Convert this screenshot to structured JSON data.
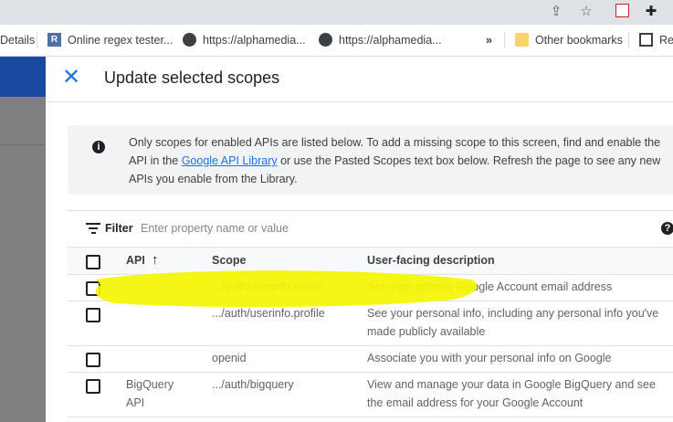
{
  "browser": {
    "bookmarks": [
      {
        "label": "Details",
        "icon": "page-icon"
      },
      {
        "label": "Online regex tester...",
        "icon": "regex-icon"
      },
      {
        "label": "https://alphamedia...",
        "icon": "globe-icon"
      },
      {
        "label": "https://alphamedia...",
        "icon": "globe-icon"
      },
      {
        "label": "»",
        "icon": "chevron-icon"
      },
      {
        "label": "Other bookmarks",
        "icon": "folder-icon"
      },
      {
        "label": "Re",
        "icon": "reading-list-icon"
      }
    ]
  },
  "dialog": {
    "title": "Update selected scopes",
    "info": {
      "before_link": "Only scopes for enabled APIs are listed below. To add a missing scope to this screen, find and enable the API in the ",
      "link": "Google API Library",
      "after_link": " or use the Pasted Scopes text box below. Refresh the page to see any new APIs you enable from the Library."
    },
    "filter": {
      "label": "Filter",
      "placeholder": "Enter property name or value"
    },
    "table": {
      "columns": [
        "API",
        "Scope",
        "User-facing description"
      ],
      "sort_column": "API",
      "rows": [
        {
          "api": "",
          "scope": ".../auth/userinfo.email",
          "description": "See your primary Google Account email address"
        },
        {
          "api": "",
          "scope": ".../auth/userinfo.profile",
          "description": "See your personal info, including any personal info you've made publicly available"
        },
        {
          "api": "",
          "scope": "openid",
          "description": "Associate you with your personal info on Google"
        },
        {
          "api": "BigQuery API",
          "scope": ".../auth/bigquery",
          "description": "View and manage your data in Google BigQuery and see the email address for your Google Account"
        }
      ]
    }
  },
  "colors": {
    "accent": "#1a73e8",
    "highlight": "#f5f500"
  }
}
